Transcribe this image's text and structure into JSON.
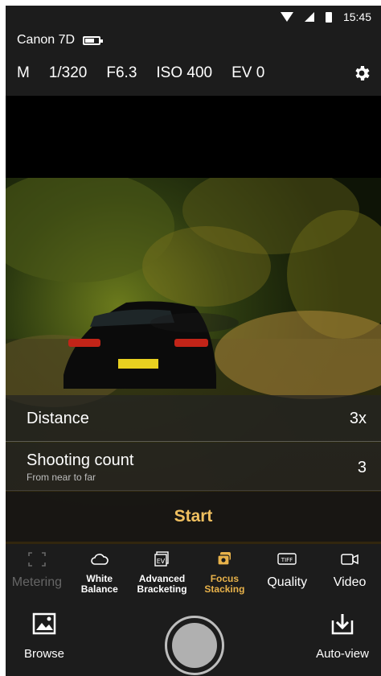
{
  "status_bar": {
    "time": "15:45"
  },
  "camera": {
    "name": "Canon 7D",
    "battery_level": 0.7
  },
  "exposure": {
    "mode": "M",
    "shutter": "1/320",
    "aperture": "F6.3",
    "iso": "ISO 400",
    "ev": "EV 0"
  },
  "icons": {
    "settings": "gear-icon",
    "browse": "gallery-icon",
    "autoview": "download-icon"
  },
  "focus_stacking": {
    "distance_label": "Distance",
    "distance_value": "3x",
    "count_label": "Shooting count",
    "count_sub": "From near to far",
    "count_value": "3",
    "start_label": "Start"
  },
  "modes": [
    {
      "name": "metering",
      "label": "Metering",
      "state": "disabled"
    },
    {
      "name": "white-balance",
      "label": "White\nBalance",
      "state": "normal"
    },
    {
      "name": "advanced-bracketing",
      "label": "Advanced\nBracketing",
      "state": "normal"
    },
    {
      "name": "focus-stacking",
      "label": "Focus\nStacking",
      "state": "active"
    },
    {
      "name": "quality",
      "label": "Quality",
      "state": "normal"
    },
    {
      "name": "video",
      "label": "Video",
      "state": "normal"
    }
  ],
  "bottom": {
    "browse_label": "Browse",
    "autoview_label": "Auto-view"
  },
  "colors": {
    "accent": "#e8b24a",
    "start_text": "#f0c060",
    "background": "#1c1c1c"
  }
}
